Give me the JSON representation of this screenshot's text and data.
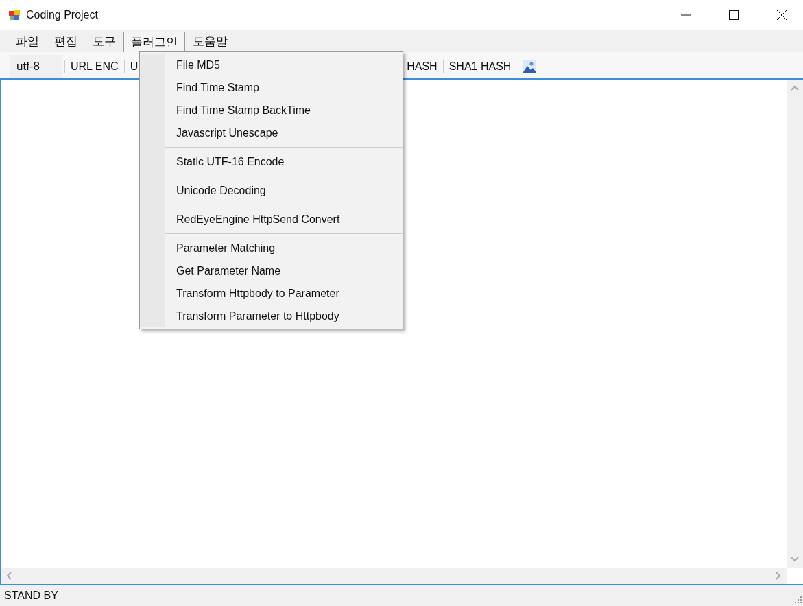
{
  "window": {
    "title": "Coding Project"
  },
  "menu_bar": [
    {
      "label": "파일",
      "selected": false
    },
    {
      "label": "편집",
      "selected": false
    },
    {
      "label": "도구",
      "selected": false
    },
    {
      "label": "플러그인",
      "selected": true
    },
    {
      "label": "도움말",
      "selected": false
    }
  ],
  "toolbar": [
    {
      "kind": "label",
      "label": "utf-8"
    },
    {
      "kind": "button",
      "label": "URL ENC"
    },
    {
      "kind": "button",
      "label": "U"
    },
    {
      "kind": "button",
      "label": "HASH",
      "after_menu": true
    },
    {
      "kind": "button",
      "label": "SHA1 HASH"
    },
    {
      "kind": "icon"
    }
  ],
  "dropdown_menu": [
    {
      "kind": "item",
      "label": "File MD5"
    },
    {
      "kind": "item",
      "label": "Find Time Stamp"
    },
    {
      "kind": "item",
      "label": "Find Time Stamp BackTime"
    },
    {
      "kind": "item",
      "label": "Javascript Unescape"
    },
    {
      "kind": "separator"
    },
    {
      "kind": "item",
      "label": "Static UTF-16 Encode"
    },
    {
      "kind": "separator"
    },
    {
      "kind": "item",
      "label": "Unicode Decoding"
    },
    {
      "kind": "separator"
    },
    {
      "kind": "item",
      "label": "RedEyeEngine HttpSend Convert"
    },
    {
      "kind": "separator"
    },
    {
      "kind": "item",
      "label": "Parameter Matching"
    },
    {
      "kind": "item",
      "label": "Get Parameter Name"
    },
    {
      "kind": "item",
      "label": "Transform Httpbody to Parameter"
    },
    {
      "kind": "item",
      "label": "Transform Parameter to Httpbody"
    }
  ],
  "status_bar": {
    "text": "STAND BY"
  }
}
